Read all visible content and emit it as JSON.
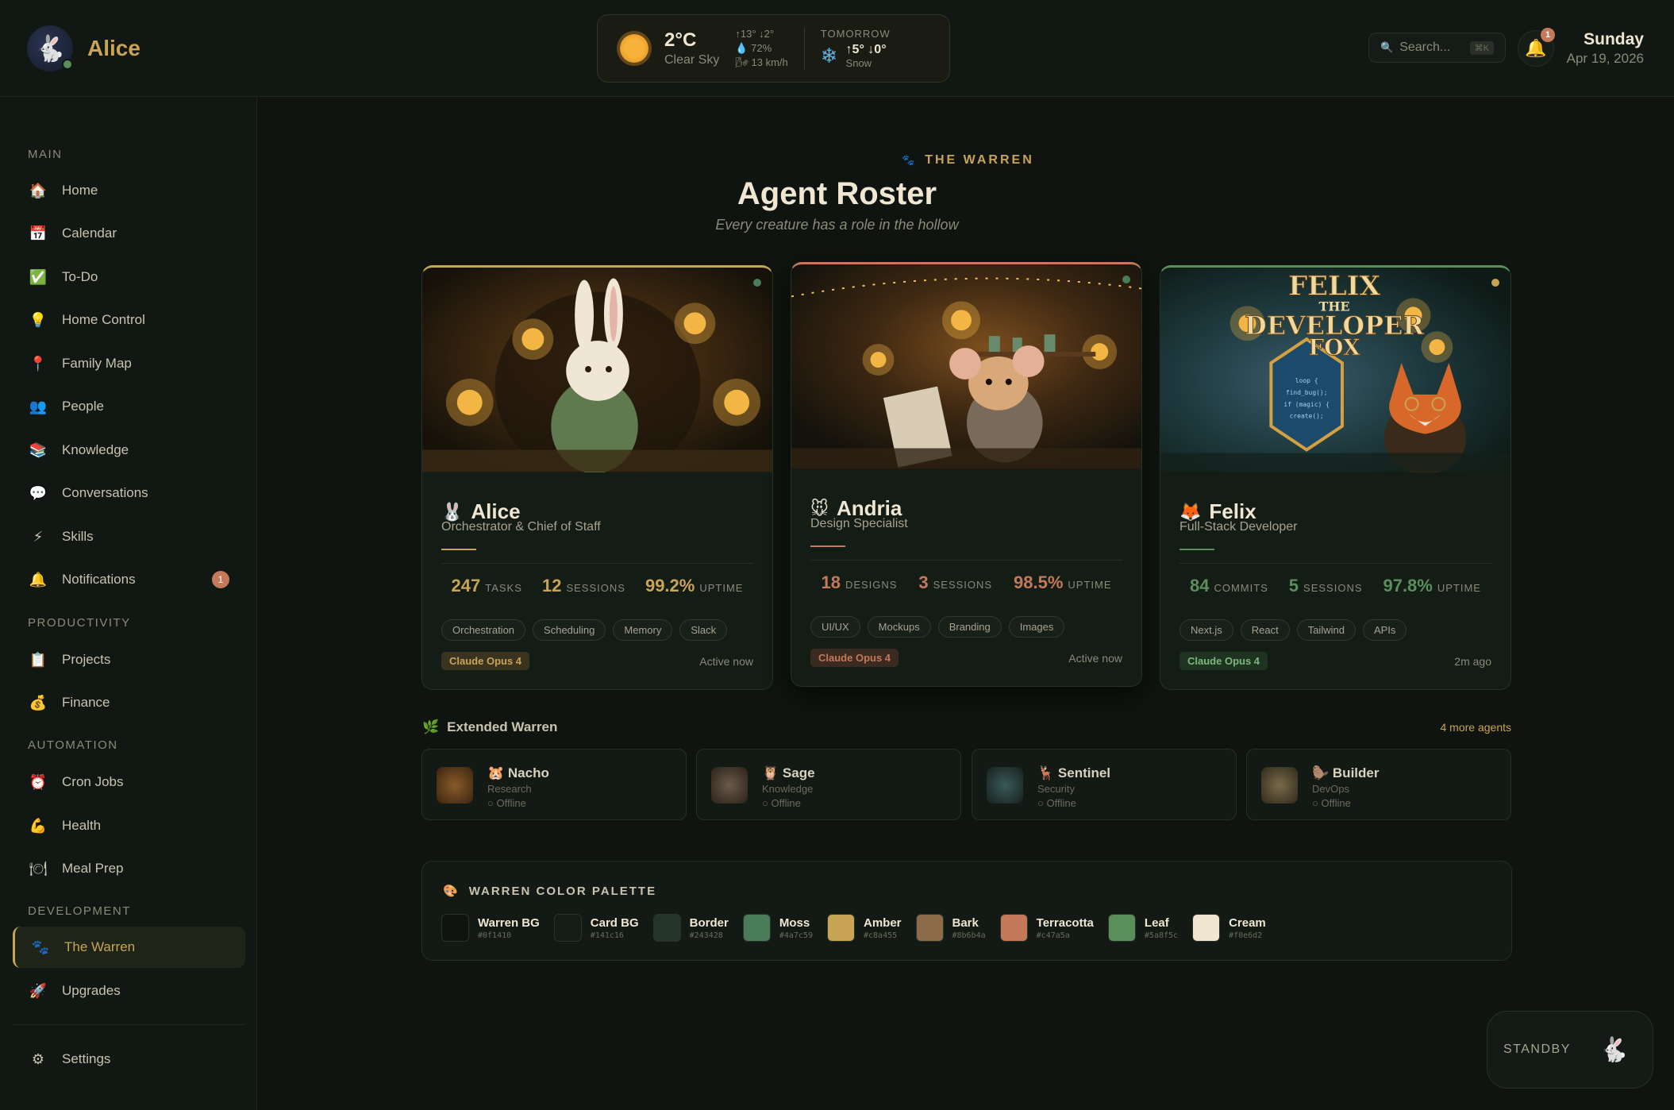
{
  "brand": {
    "name": "Alice",
    "avatar_icon": "rabbit-icon"
  },
  "weather": {
    "temp": "2°C",
    "desc": "Clear Sky",
    "hi_lo": "↑13° ↓2°",
    "humidity": "72%",
    "wind": "13 km/h",
    "tomorrow_label": "TOMORROW",
    "tomorrow_temp": "↑5° ↓0°",
    "tomorrow_desc": "Snow"
  },
  "search": {
    "placeholder": "Search...",
    "shortcut": "⌘K"
  },
  "notifications": {
    "count": "1"
  },
  "date": {
    "day": "Sunday",
    "full": "Apr 19, 2026"
  },
  "sidebar": {
    "sections": [
      "MAIN",
      "PRODUCTIVITY",
      "AUTOMATION",
      "DEVELOPMENT"
    ],
    "items": [
      {
        "label": "Home",
        "icon": "🏠"
      },
      {
        "label": "Calendar",
        "icon": "📅"
      },
      {
        "label": "To-Do",
        "icon": "✅"
      },
      {
        "label": "Home Control",
        "icon": "💡"
      },
      {
        "label": "Family Map",
        "icon": "📍"
      },
      {
        "label": "People",
        "icon": "👥"
      },
      {
        "label": "Knowledge",
        "icon": "📚"
      },
      {
        "label": "Conversations",
        "icon": "💬"
      },
      {
        "label": "Skills",
        "icon": "⚡"
      },
      {
        "label": "Notifications",
        "icon": "🔔",
        "badge": "1"
      },
      {
        "label": "Projects",
        "icon": "📋"
      },
      {
        "label": "Finance",
        "icon": "💰"
      },
      {
        "label": "Cron Jobs",
        "icon": "⏰"
      },
      {
        "label": "Health",
        "icon": "💪"
      },
      {
        "label": "Meal Prep",
        "icon": "🍽"
      },
      {
        "label": "The Warren",
        "icon": "🐾"
      },
      {
        "label": "Upgrades",
        "icon": "🚀"
      },
      {
        "label": "Settings",
        "icon": "⚙"
      }
    ]
  },
  "page": {
    "eyebrow": "THE WARREN",
    "title": "Agent Roster",
    "subtitle": "Every creature has a role in the hollow"
  },
  "agents": [
    {
      "name": "Alice",
      "emoji": "🐰",
      "role": "Orchestrator & Chief of Staff",
      "stats": [
        {
          "value": "247",
          "label": "TASKS"
        },
        {
          "value": "12",
          "label": "SESSIONS"
        },
        {
          "value": "99.2%",
          "label": "UPTIME"
        }
      ],
      "tags": [
        "Orchestration",
        "Scheduling",
        "Memory",
        "Slack"
      ],
      "model": "Claude Opus 4",
      "last_seen": "Active now",
      "accent": "#c8a455"
    },
    {
      "name": "Andria",
      "emoji": "🐭",
      "role": "Design Specialist",
      "stats": [
        {
          "value": "18",
          "label": "DESIGNS"
        },
        {
          "value": "3",
          "label": "SESSIONS"
        },
        {
          "value": "98.5%",
          "label": "UPTIME"
        }
      ],
      "tags": [
        "UI/UX",
        "Mockups",
        "Branding",
        "Images"
      ],
      "model": "Claude Opus 4",
      "last_seen": "Active now",
      "accent": "#c47a5a"
    },
    {
      "name": "Felix",
      "emoji": "🦊",
      "role": "Full-Stack Developer",
      "stats": [
        {
          "value": "84",
          "label": "COMMITS"
        },
        {
          "value": "5",
          "label": "SESSIONS"
        },
        {
          "value": "97.8%",
          "label": "UPTIME"
        }
      ],
      "tags": [
        "Next.js",
        "React",
        "Tailwind",
        "APIs"
      ],
      "model": "Claude Opus 4",
      "last_seen": "2m ago",
      "accent": "#5a8f5c",
      "art_text": [
        "FELIX",
        "THE",
        "DEVELOPER",
        "FOX"
      ]
    }
  ],
  "extended": {
    "title": "Extended Warren",
    "more": "4 more agents",
    "agents": [
      {
        "name": "Nacho",
        "emoji": "🐹",
        "role": "Research",
        "status": "○ Offline"
      },
      {
        "name": "Sage",
        "emoji": "🦉",
        "role": "Knowledge",
        "status": "○ Offline"
      },
      {
        "name": "Sentinel",
        "emoji": "🦌",
        "role": "Security",
        "status": "○ Offline"
      },
      {
        "name": "Builder",
        "emoji": "🦫",
        "role": "DevOps",
        "status": "○ Offline"
      }
    ]
  },
  "palette": {
    "title": "WARREN COLOR PALETTE",
    "colors": [
      {
        "name": "Warren BG",
        "hex": "#0f1410"
      },
      {
        "name": "Card BG",
        "hex": "#141c16"
      },
      {
        "name": "Border",
        "hex": "#243428"
      },
      {
        "name": "Moss",
        "hex": "#4a7c59"
      },
      {
        "name": "Amber",
        "hex": "#c8a455"
      },
      {
        "name": "Bark",
        "hex": "#8b6b4a"
      },
      {
        "name": "Terracotta",
        "hex": "#c47a5a"
      },
      {
        "name": "Leaf",
        "hex": "#5a8f5c"
      },
      {
        "name": "Cream",
        "hex": "#f0e6d2"
      }
    ]
  },
  "standby": {
    "label": "STANDBY"
  }
}
